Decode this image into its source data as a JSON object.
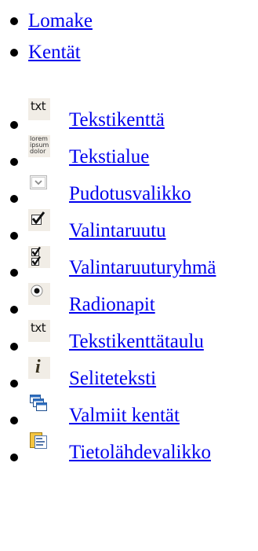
{
  "nav": [
    {
      "label": "Lomake"
    },
    {
      "label": "Kentät"
    }
  ],
  "fields": [
    {
      "label": "Tekstikenttä",
      "icon": "text-field-icon",
      "icon_text": "txt"
    },
    {
      "label": "Tekstialue",
      "icon": "text-area-icon",
      "icon_text": "lorem ipsum dolor"
    },
    {
      "label": "Pudotusvalikko",
      "icon": "dropdown-icon"
    },
    {
      "label": "Valintaruutu",
      "icon": "checkbox-icon"
    },
    {
      "label": "Valintaruuturyhmä",
      "icon": "checkbox-group-icon"
    },
    {
      "label": "Radionapit",
      "icon": "radio-button-icon"
    },
    {
      "label": "Tekstikenttätaulu",
      "icon": "text-field-table-icon",
      "icon_text": "txt"
    },
    {
      "label": "Seliteteksti",
      "icon": "info-text-icon",
      "icon_text": "i"
    },
    {
      "label": "Valmiit kentät",
      "icon": "ready-fields-icon"
    },
    {
      "label": "Tietolähdevalikko",
      "icon": "data-source-icon"
    }
  ],
  "colors": {
    "link": "#0000ee",
    "text": "#000000",
    "icon_bg": "#f1ede6"
  }
}
